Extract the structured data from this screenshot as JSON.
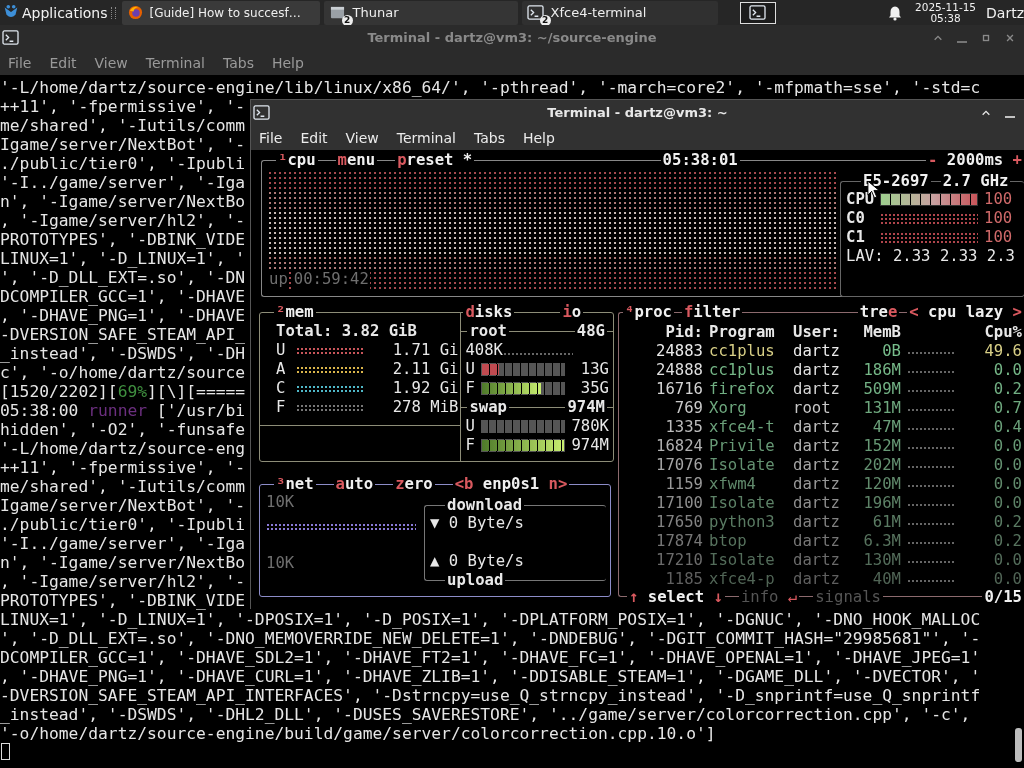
{
  "taskbar": {
    "menu_label": "Applications",
    "tasks": [
      {
        "kind": "browser",
        "label": "[Guide] How to succesf…"
      },
      {
        "kind": "files",
        "label": "Thunar",
        "badge": "2"
      },
      {
        "kind": "terminal",
        "label": "Xfce4-terminal",
        "badge": "2"
      }
    ],
    "clock": {
      "date": "2025-11-15",
      "time": "05:38"
    },
    "user": "Dartz"
  },
  "back_window": {
    "title": "Terminal - dartz@vm3: ~/source-engine",
    "active": false,
    "menu": [
      "File",
      "Edit",
      "View",
      "Terminal",
      "Tabs",
      "Help"
    ],
    "lines": [
      {
        "text": "'-L/home/dartz/source-engine/lib/linux/x86_64/', '-pthread', '-march=core2', '-mfpmath=sse', '-std=c"
      },
      {
        "text": "++11', '-fpermissive', '-"
      },
      {
        "text": "me/shared', '-Iutils/comm"
      },
      {
        "text": "Igame/server/NextBot', '-"
      },
      {
        "text": "./public/tier0', '-Ipubli"
      },
      {
        "text": "'-I../game/server', '-Iga"
      },
      {
        "text": "n', '-Igame/server/NextBo"
      },
      {
        "text": ", '-Igame/server/hl2', '-"
      },
      {
        "text": "PROTOTYPES', '-DBINK_VIDE"
      },
      {
        "text": "LINUX=1', '-D_LINUX=1', '"
      },
      {
        "text": "', '-D_DLL_EXT=.so', '-DN"
      },
      {
        "text": "DCOMPILER_GCC=1', '-DHAVE"
      },
      {
        "text": ", '-DHAVE_PNG=1', '-DHAVE"
      },
      {
        "text": "-DVERSION_SAFE_STEAM_API_"
      },
      {
        "text": "_instead', '-DSWDS', '-DH"
      },
      {
        "text": "c', '-o/home/dartz/source"
      },
      {
        "parts": [
          {
            "text": "[1520/2202]["
          },
          {
            "text": "69%",
            "color": "#3f8f3f"
          },
          {
            "text": "][\\][====="
          }
        ]
      },
      {
        "parts": [
          {
            "text": "05:38:00 "
          },
          {
            "text": "runner",
            "color": "#6b2f7f"
          },
          {
            "text": " ['/usr/bi"
          }
        ]
      },
      {
        "text": "hidden', '-O2', '-funsafe"
      },
      {
        "text": "'-L/home/dartz/source-eng"
      },
      {
        "text": "++11', '-fpermissive', '-"
      },
      {
        "text": "me/shared', '-Iutils/comm"
      },
      {
        "text": "Igame/server/NextBot', '-"
      },
      {
        "text": "./public/tier0', '-Ipubli"
      },
      {
        "text": "'-I../game/server', '-Iga"
      },
      {
        "text": "n', '-Igame/server/NextBo"
      },
      {
        "text": ", '-Igame/server/hl2', '-"
      },
      {
        "text": "PROTOTYPES', '-DBINK_VIDE"
      },
      {
        "text": "LINUX=1', '-D_LINUX=1', '-DPOSIX=1', '-D_POSIX=1', '-DPLATFORM_POSIX=1', '-DGNUC', '-DNO_HOOK_MALLOC"
      },
      {
        "text": "', '-D_DLL_EXT=.so', '-DNO_MEMOVERRIDE_NEW_DELETE=1', '-DNDEBUG', '-DGIT_COMMIT_HASH=\"29985681\"', '-"
      },
      {
        "text": "DCOMPILER_GCC=1', '-DHAVE_SDL2=1', '-DHAVE_FT2=1', '-DHAVE_FC=1', '-DHAVE_OPENAL=1', '-DHAVE_JPEG=1'"
      },
      {
        "text": ", '-DHAVE_PNG=1', '-DHAVE_CURL=1', '-DHAVE_ZLIB=1', '-DDISABLE_STEAM=1', '-DGAME_DLL', '-DVECTOR', '"
      },
      {
        "text": "-DVERSION_SAFE_STEAM_API_INTERFACES', '-Dstrncpy=use_Q_strncpy_instead', '-D_snprintf=use_Q_snprintf"
      },
      {
        "text": "_instead', '-DSWDS', '-DHL2_DLL', '-DUSES_SAVERESTORE', '../game/server/colorcorrection.cpp', '-c',"
      },
      {
        "text": "'-o/home/dartz/source-engine/build/game/server/colorcorrection.cpp.10.o']"
      }
    ]
  },
  "front_window": {
    "title": "Terminal - dartz@vm3: ~",
    "active": true,
    "menu": [
      "File",
      "Edit",
      "View",
      "Terminal",
      "Tabs",
      "Help"
    ],
    "btop": {
      "cpu": {
        "titles": [
          {
            "parts": [
              {
                "text": "¹",
                "accent": true
              },
              {
                "text": "cpu",
                "accent": false
              }
            ]
          },
          {
            "parts": [
              {
                "text": "m",
                "accent": true
              },
              {
                "text": "enu",
                "accent": false
              }
            ]
          },
          {
            "parts": [
              {
                "text": "p",
                "accent": true
              },
              {
                "text": "reset *",
                "accent": false
              }
            ]
          },
          {
            "parts": [
              {
                "text": "05:38:01",
                "accent": false
              }
            ]
          },
          {
            "parts": [
              {
                "text": "-",
                "accent": true
              },
              {
                "text": " 2000ms ",
                "accent": false
              },
              {
                "text": "+",
                "accent": true
              }
            ]
          }
        ],
        "uptime_label": "up",
        "uptime": "00:59:42",
        "model": "E5-2697",
        "frequency": "2.7 GHz",
        "rows": [
          {
            "kind": "meter",
            "label": "CPU",
            "level": 1,
            "value": "100"
          },
          {
            "kind": "graph",
            "label": "C0",
            "value": "100"
          },
          {
            "kind": "graph",
            "label": "C1",
            "value": "100"
          }
        ],
        "load": "LAV: 2.33 2.33 2.3"
      },
      "mem": {
        "titles": [
          {
            "parts": [
              {
                "text": "²",
                "accent": true
              },
              {
                "text": "mem",
                "accent": false
              }
            ]
          }
        ],
        "total": "Total: 3.82 GiB",
        "rows": [
          {
            "label": "U",
            "value": "1.71 Gi",
            "color": "#c8555a"
          },
          {
            "label": "A",
            "value": "2.11 Gi",
            "color": "#d9b44a"
          },
          {
            "label": "C",
            "value": "1.92 Gi",
            "color": "#4fb8c8"
          },
          {
            "label": "F",
            "value": "278 MiB",
            "color": "#777777"
          }
        ]
      },
      "disks": {
        "titles": [
          {
            "parts": [
              {
                "text": "d",
                "accent": true
              },
              {
                "text": "isks",
                "accent": false
              }
            ]
          },
          {
            "parts": [
              {
                "text": "i",
                "accent": true
              },
              {
                "text": "o",
                "accent": false
              }
            ]
          }
        ],
        "volumes": [
          {
            "name": "root",
            "size": "48G",
            "io": "408K",
            "rows": [
              {
                "kind": "used",
                "label": "U",
                "level": 0.2,
                "value": "13G"
              },
              {
                "kind": "free",
                "label": "F",
                "level": 0.7,
                "value": "35G"
              }
            ]
          },
          {
            "name": "swap",
            "size": "974M",
            "rows": [
              {
                "kind": "used",
                "label": "U",
                "level": 0,
                "value": "780K"
              },
              {
                "kind": "free",
                "label": "F",
                "level": 1,
                "value": "974M"
              }
            ]
          }
        ]
      },
      "net": {
        "titles": [
          {
            "parts": [
              {
                "text": "³",
                "accent": true
              },
              {
                "text": "net",
                "accent": false
              }
            ]
          },
          {
            "parts": [
              {
                "text": "a",
                "accent": true
              },
              {
                "text": "uto",
                "accent": false
              }
            ]
          },
          {
            "parts": [
              {
                "text": "z",
                "accent": true
              },
              {
                "text": "ero",
                "accent": false
              }
            ]
          },
          {
            "parts": [
              {
                "text": "<b",
                "accent": true
              },
              {
                "text": " enp0s1 ",
                "accent": false
              },
              {
                "text": "n>",
                "accent": true
              }
            ]
          }
        ],
        "scale_top": "10K",
        "scale_bottom": "10K",
        "download": {
          "label": "download",
          "arrow": "▼",
          "rate": "0 Byte/s"
        },
        "upload": {
          "label": "upload",
          "arrow": "▲",
          "rate": "0 Byte/s"
        }
      },
      "proc": {
        "titles": [
          {
            "parts": [
              {
                "text": "⁴",
                "accent": true
              },
              {
                "text": "proc",
                "accent": false
              }
            ]
          },
          {
            "parts": [
              {
                "text": "f",
                "accent": true
              },
              {
                "text": "ilter",
                "accent": false
              }
            ]
          },
          {
            "parts": [
              {
                "text": "tre",
                "accent": false
              },
              {
                "text": "e",
                "accent": true
              }
            ]
          },
          {
            "parts": [
              {
                "text": "<",
                "accent": true
              },
              {
                "text": " cpu lazy ",
                "accent": false
              },
              {
                "text": ">",
                "accent": true
              }
            ]
          }
        ],
        "columns": [
          "Pid:",
          "Program",
          "User:",
          "MemB",
          "Cpu%"
        ],
        "rows": [
          {
            "pid": "24883",
            "program": "cc1plus",
            "user": "dartz",
            "mem": "0B",
            "cpu": "49.6"
          },
          {
            "pid": "24888",
            "program": "cc1plus",
            "user": "dartz",
            "mem": "186M",
            "cpu": "0.0"
          },
          {
            "pid": "16716",
            "program": "firefox",
            "user": "dartz",
            "mem": "509M",
            "cpu": "0.2"
          },
          {
            "pid": "769",
            "program": "Xorg",
            "user": "root",
            "mem": "131M",
            "cpu": "0.7"
          },
          {
            "pid": "1335",
            "program": "xfce4-t",
            "user": "dartz",
            "mem": "47M",
            "cpu": "0.4"
          },
          {
            "pid": "16824",
            "program": "Privile",
            "user": "dartz",
            "mem": "152M",
            "cpu": "0.0"
          },
          {
            "pid": "17076",
            "program": "Isolate",
            "user": "dartz",
            "mem": "202M",
            "cpu": "0.0"
          },
          {
            "pid": "1159",
            "program": "xfwm4",
            "user": "dartz",
            "mem": "120M",
            "cpu": "0.0"
          },
          {
            "pid": "17100",
            "program": "Isolate",
            "user": "dartz",
            "mem": "196M",
            "cpu": "0.0"
          },
          {
            "pid": "17650",
            "program": "python3",
            "user": "dartz",
            "mem": "61M",
            "cpu": "0.2"
          },
          {
            "pid": "17874",
            "program": "btop",
            "user": "dartz",
            "mem": "6.3M",
            "cpu": "0.2"
          },
          {
            "pid": "17210",
            "program": "Isolate",
            "user": "dartz",
            "mem": "130M",
            "cpu": "0.0"
          },
          {
            "pid": "1185",
            "program": "xfce4-p",
            "user": "dartz",
            "mem": "40M",
            "cpu": "0.0"
          }
        ],
        "footer": [
          {
            "parts": [
              {
                "text": "↑",
                "accent": true
              },
              {
                "text": " select ",
                "accent": false
              },
              {
                "text": "↓",
                "accent": true
              }
            ],
            "disabled": false
          },
          {
            "parts": [
              {
                "text": "info ",
                "accent": false
              },
              {
                "text": "↵",
                "accent": true
              }
            ],
            "disabled": true
          },
          {
            "parts": [
              {
                "text": "signals",
                "accent": false
              }
            ],
            "disabled": true
          }
        ],
        "count": "0/15"
      }
    }
  }
}
